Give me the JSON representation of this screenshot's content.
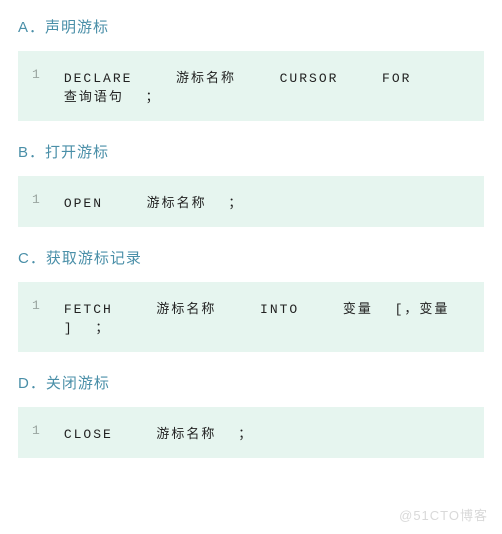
{
  "sections": [
    {
      "heading": "A．声明游标",
      "line_no": "1",
      "code": "DECLARE  游标名称  CURSOR  FOR  查询语句 ；"
    },
    {
      "heading": "B．打开游标",
      "line_no": "1",
      "code": "OPEN  游标名称 ；"
    },
    {
      "heading": "C．获取游标记录",
      "line_no": "1",
      "code": "FETCH  游标名称  INTO  变量 [，变量  ] ；"
    },
    {
      "heading": "D．关闭游标",
      "line_no": "1",
      "code": "CLOSE  游标名称 ；"
    }
  ],
  "watermark": "@51CTO博客"
}
